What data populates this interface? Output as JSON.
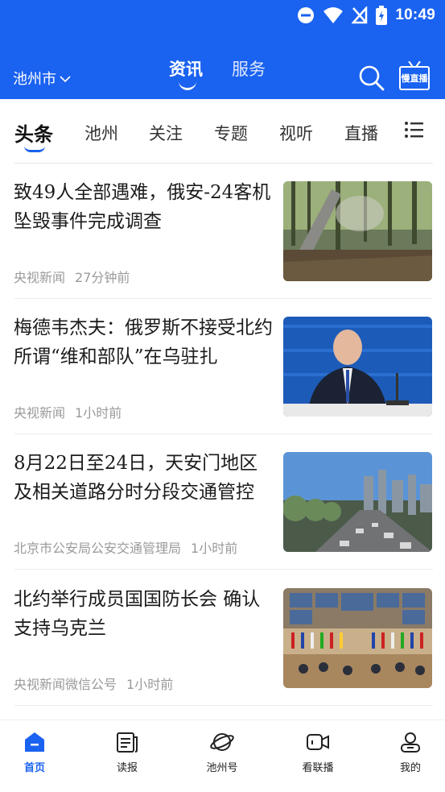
{
  "status_bar": {
    "time": "10:49"
  },
  "header": {
    "city": "池州市",
    "tabs": [
      {
        "label": "资讯",
        "active": true
      },
      {
        "label": "服务",
        "active": false
      }
    ],
    "live_label": "慢直播"
  },
  "channels": [
    {
      "label": "头条",
      "active": true
    },
    {
      "label": "池州"
    },
    {
      "label": "关注"
    },
    {
      "label": "专题"
    },
    {
      "label": "视听"
    },
    {
      "label": "直播"
    }
  ],
  "news": [
    {
      "title": "致49人全部遇难，俄安-24客机坠毁事件完成调查",
      "source": "央视新闻",
      "time": "27分钟前"
    },
    {
      "title": "梅德韦杰夫：俄罗斯不接受北约所谓“维和部队”在乌驻扎",
      "source": "央视新闻",
      "time": "1小时前"
    },
    {
      "title": "8月22日至24日，天安门地区及相关道路分时分段交通管控",
      "source": "北京市公安局公安交通管理局",
      "time": "1小时前"
    },
    {
      "title": "北约举行成员国国防长会 确认支持乌克兰",
      "source": "央视新闻微信公号",
      "time": "1小时前"
    }
  ],
  "bottom_nav": [
    {
      "label": "首页",
      "icon": "home-icon",
      "active": true
    },
    {
      "label": "读报",
      "icon": "newspaper-icon"
    },
    {
      "label": "池州号",
      "icon": "planet-icon"
    },
    {
      "label": "看联播",
      "icon": "video-icon"
    },
    {
      "label": "我的",
      "icon": "profile-icon"
    }
  ],
  "colors": {
    "brand": "#1a62f0",
    "meta": "#9a9a9a"
  }
}
